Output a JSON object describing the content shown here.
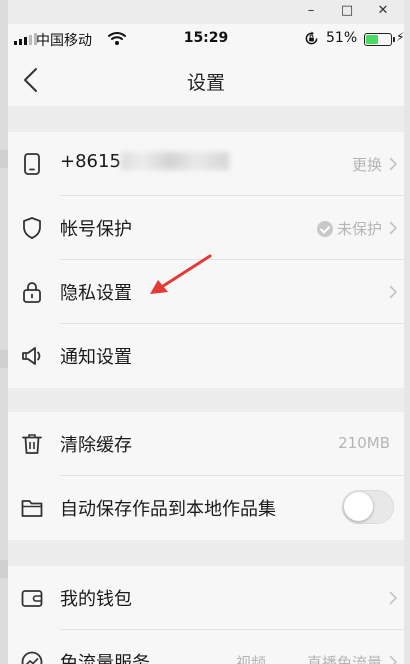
{
  "window": {
    "minimize": "–",
    "maximize": "□",
    "close": "✕"
  },
  "status": {
    "carrier": "中国移动",
    "time": "15:29",
    "battery_pct": "51%",
    "battery_level": 0.51,
    "icons": [
      "signal-icon",
      "wifi-icon",
      "rotation-lock-icon",
      "battery-icon",
      "charging-icon"
    ]
  },
  "nav": {
    "title": "设置",
    "back_icon": "back-chevron-icon"
  },
  "groups": {
    "account": {
      "phone": {
        "label": "+8615",
        "value": "更换"
      },
      "security": {
        "label": "帐号保护",
        "value": "未保护"
      },
      "privacy": {
        "label": "隐私设置"
      },
      "notify": {
        "label": "通知设置"
      }
    },
    "storage": {
      "cache": {
        "label": "清除缓存",
        "value": "210MB"
      },
      "autosave": {
        "label": "自动保存作品到本地作品集",
        "enabled": false
      }
    },
    "wallet": {
      "wallet": {
        "label": "我的钱包"
      },
      "free_data": {
        "label": "免流量服务",
        "value_a": "视频",
        "value_b": "直播免流量"
      }
    }
  },
  "colors": {
    "background": "#ececec",
    "cell": "#f7f7f7",
    "annotation_arrow": "#e53935",
    "battery_fill": "#4cd964"
  }
}
